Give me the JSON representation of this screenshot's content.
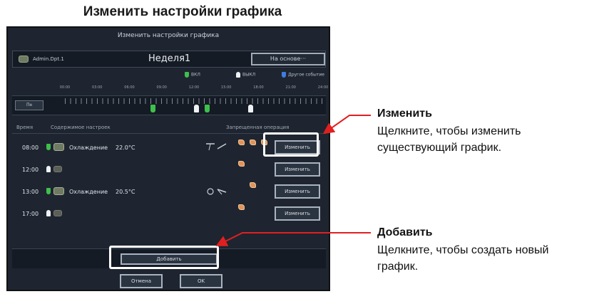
{
  "doc_title": "Изменить настройки графика",
  "window": {
    "title": "Изменить настройки графика",
    "group_name": "Admin.Dpt.1",
    "week_name": "Неделя1",
    "based_on_label": "На основе···"
  },
  "legend": {
    "on": "ВКЛ",
    "off": "ВЫКЛ",
    "other": "Другое событие"
  },
  "timeline": {
    "ticks": [
      "00:00",
      "03:00",
      "06:00",
      "09:00",
      "12:00",
      "15:00",
      "18:00",
      "21:00",
      "24:00"
    ],
    "day_label": "Пн"
  },
  "list": {
    "col_time": "Время",
    "col_settings": "Содержимое настроек",
    "col_prohibited": "Запрещенная операция",
    "rows": [
      {
        "time": "08:00",
        "mode": "Охлаждение",
        "temp": "22.0°C",
        "edit": "Изменить"
      },
      {
        "time": "12:00",
        "mode": "",
        "temp": "",
        "edit": "Изменить"
      },
      {
        "time": "13:00",
        "mode": "Охлаждение",
        "temp": "20.5°C",
        "edit": "Изменить"
      },
      {
        "time": "17:00",
        "mode": "",
        "temp": "",
        "edit": "Изменить"
      }
    ]
  },
  "buttons": {
    "add": "Добавить",
    "cancel": "Отмена",
    "ok": "OK"
  },
  "callouts": {
    "edit_title": "Изменить",
    "edit_desc_1": "Щелкните, чтобы изменить",
    "edit_desc_2": "существующий график.",
    "add_title": "Добавить",
    "add_desc_1": "Щелкните, чтобы создать новый",
    "add_desc_2": "график."
  },
  "colors": {
    "on_marker": "#3fbf4c",
    "off_marker": "#eef2f6",
    "other_marker": "#3f7de0",
    "callout_arrow": "#e02020"
  }
}
